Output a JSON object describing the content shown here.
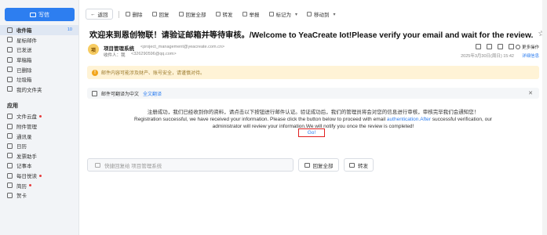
{
  "sidebar": {
    "compose_label": "写信",
    "items": [
      {
        "label": "收件箱",
        "count": "10",
        "active": true
      },
      {
        "label": "星标邮件"
      },
      {
        "label": "已发送"
      },
      {
        "label": "草稿箱"
      },
      {
        "label": "已删除"
      },
      {
        "label": "垃圾箱"
      },
      {
        "label": "我的文件夹"
      }
    ],
    "apps_title": "应用",
    "apps": [
      {
        "label": "文件云盘",
        "dot": true
      },
      {
        "label": "附件管理"
      },
      {
        "label": "通讯录"
      },
      {
        "label": "日历"
      },
      {
        "label": "发票助手"
      },
      {
        "label": "记事本"
      },
      {
        "label": "每日悦读",
        "dot": true
      },
      {
        "label": "简历",
        "dot": true
      },
      {
        "label": "贺卡"
      }
    ]
  },
  "toolbar": {
    "back": "返回",
    "delete": "删除",
    "reply": "回复",
    "reply_all": "回复全部",
    "forward": "转发",
    "spam": "举报",
    "mark": "标记为",
    "move": "移动到"
  },
  "email": {
    "subject": "欢迎来到恩创物联！请验证邮箱并等待审核。/Welcome to YeaCreate Iot!Please verify your email and wait for the review.",
    "avatar_text": "项",
    "sender_name": "项目管理系统",
    "sender_email": "<project_management@yeacreate.com.cn>",
    "recipient_label": "收件人：我",
    "recipient_email": "<326290596@qq.com>",
    "date": "2025年3月30日(周日) 15:42",
    "more_label": "更多操作",
    "detail_label": "详细信息",
    "warning": "邮件内容可能涉及财产、账号安全，请谨慎对待。",
    "translate_text": "邮件可翻译为中文",
    "translate_link": "全文翻译",
    "body_cn": "注册成功，我们已经收到你的资料，请点击以下按钮进行邮件认证。验证成功后，我们的管理员将会对您的信息进行审核，审核完毕我们会通知您！",
    "body_en_1": "Registration successful, we have received your information. Please click the button below to proceed with email ",
    "body_en_link": "authentication.After",
    "body_en_2": " successful verification, our administrator will review your information.We will notify you once the review is completed!",
    "go_button": "Go!"
  },
  "reply_bar": {
    "placeholder": "快捷回复给 项目管理系统",
    "reply_all": "回复全部",
    "forward": "转发"
  }
}
